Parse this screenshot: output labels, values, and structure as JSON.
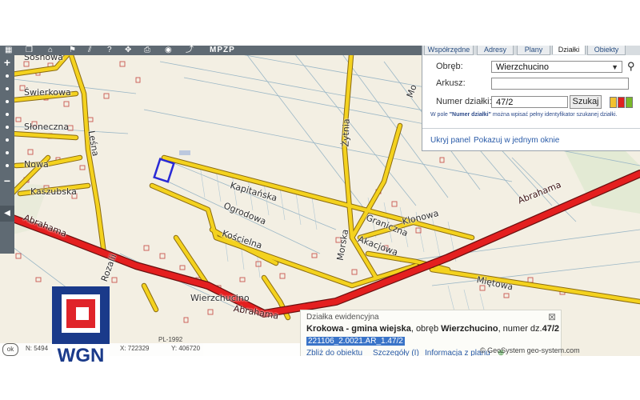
{
  "toolbar": {
    "mpzp_label": "MPZP"
  },
  "zoom": {
    "in_label": "+",
    "out_label": "−",
    "collapse_label": "◀"
  },
  "tabs": [
    "Współrzędne",
    "Adresy",
    "Plany",
    "Działki",
    "Obiekty"
  ],
  "panel": {
    "obreb_label": "Obręb:",
    "obreb_value": "Wierzchucino",
    "arkusz_label": "Arkusz:",
    "arkusz_value": "",
    "numer_label": "Numer działki:",
    "numer_value": "47/2",
    "search_button": "Szukaj",
    "hint_prefix": "W pole ",
    "hint_bold": "\"Numer działki\"",
    "hint_suffix": " można wpisać pełny identyfikator szukanej działki.",
    "hide_link": "Ukryj panel",
    "one_window_link": "Pokazuj w jednym oknie",
    "swatch_colors": [
      "#f2c230",
      "#e02020",
      "#7ab828"
    ]
  },
  "streets": {
    "soshowa": "Sosnowa",
    "swierkowa": "Świerkowa",
    "sloneczna": "Słoneczna",
    "nowa": "Nowa",
    "kaszubska": "Kaszubska",
    "lesna": "Leśna",
    "abrahama1": "Abrahama",
    "abrahama2": "Abrahama",
    "abrahama3": "Abrahama",
    "rozali": "Rozalii",
    "kapitanska": "Kapitańska",
    "ogrodowa": "Ogrodowa",
    "koscielna": "Kościelna",
    "zytnia": "Żytnia",
    "klonowa": "Klonowa",
    "graniczna": "Graniczna",
    "akacjowa": "Akacjowa",
    "morska": "Morska",
    "mietowa": "Miętowa",
    "wierzchucino": "Wierzchucino",
    "mo": "Mo"
  },
  "info": {
    "title": "Działka ewidencyjna",
    "gmina": "Krokowa - gmina wiejska",
    "obreb_text": ", obręb ",
    "obreb": "Wierzchucino",
    "numer_text": ", numer dz.",
    "numer": "47/2",
    "identifier": "221106_2.0021.AR_1.47/2",
    "link_zoom": "Zbliż do obiektu",
    "link_details": "Szczegóły (I)",
    "link_plan": "Informacja z planu"
  },
  "status": {
    "ok_label": "ok",
    "crs": "PL-1992",
    "x_coord": "N: 5494",
    "y_coord": "X: 722329",
    "z_coord": "Y: 406720"
  },
  "attribution": "© GeoSystem geo-system.com",
  "logo": {
    "text": "WGN",
    "colors": [
      "#1a3a8a",
      "#e0242a"
    ]
  }
}
